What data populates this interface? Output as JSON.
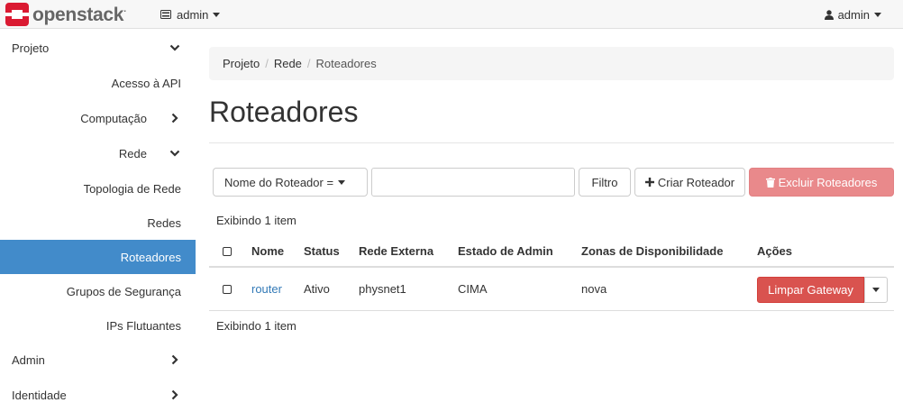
{
  "brand": {
    "name": "openstack",
    "mark": "."
  },
  "header": {
    "project": "admin",
    "user": "admin"
  },
  "sidebar": {
    "items": [
      {
        "label": "Projeto"
      },
      {
        "label": "Acesso à API"
      },
      {
        "label": "Computação"
      },
      {
        "label": "Rede"
      },
      {
        "label": "Topologia de Rede"
      },
      {
        "label": "Redes"
      },
      {
        "label": "Roteadores"
      },
      {
        "label": "Grupos de Segurança"
      },
      {
        "label": "IPs Flutuantes"
      },
      {
        "label": "Admin"
      },
      {
        "label": "Identidade"
      }
    ]
  },
  "breadcrumb": {
    "items": [
      "Projeto",
      "Rede",
      "Roteadores"
    ],
    "separator": "/"
  },
  "page": {
    "title": "Roteadores"
  },
  "toolbar": {
    "filter_field": "Nome do Roteador =",
    "filter_value": "",
    "filter_button": "Filtro",
    "create_button": "Criar Roteador",
    "delete_button": "Excluir Roteadores"
  },
  "table": {
    "count_top": "Exibindo 1 item",
    "count_bottom": "Exibindo 1 item",
    "columns": [
      "Nome",
      "Status",
      "Rede Externa",
      "Estado de Admin",
      "Zonas de Disponibilidade",
      "Ações"
    ],
    "rows": [
      {
        "name": "router",
        "status": "Ativo",
        "external_network": "physnet1",
        "admin_state": "CIMA",
        "zones": "nova",
        "action": "Limpar Gateway"
      }
    ]
  },
  "colors": {
    "active_nav": "#428bca",
    "link": "#337ab7",
    "danger": "#d9534f",
    "danger_disabled": "#e9898b",
    "brand_red": "#da1a32"
  },
  "icons": [
    "openstack-logo-icon",
    "server-icon",
    "user-icon",
    "chevron-down-icon",
    "chevron-right-icon",
    "plus-icon",
    "trash-icon",
    "caret-down-icon"
  ]
}
